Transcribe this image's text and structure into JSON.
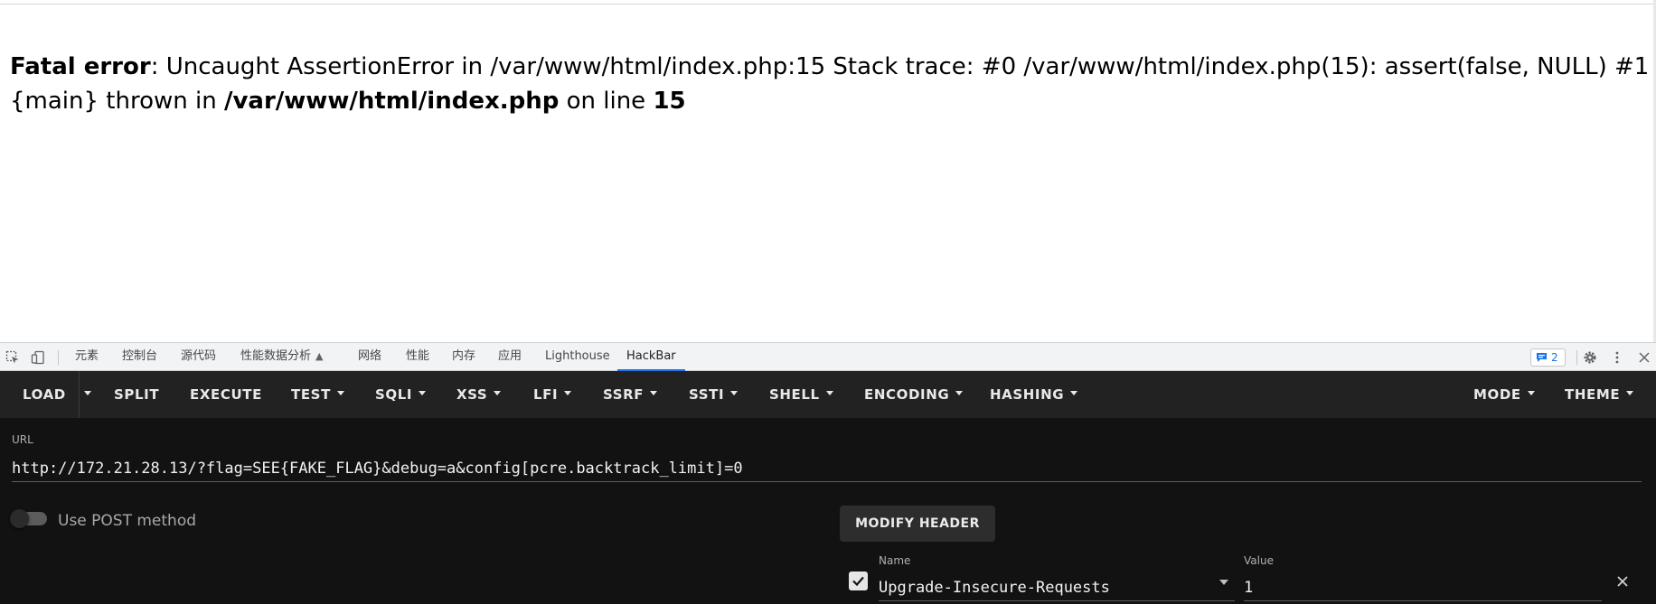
{
  "page": {
    "error_label": "Fatal error",
    "error_message": ": Uncaught AssertionError in /var/www/html/index.php:15 Stack trace: #0 /var/www/html/index.php(15): assert(false, NULL) #1 {main} thrown in ",
    "error_file": "/var/www/html/index.php",
    "on_line_text": " on line ",
    "line_number": "15"
  },
  "devtools": {
    "tabs": [
      {
        "label": "元素"
      },
      {
        "label": "控制台"
      },
      {
        "label": "源代码"
      },
      {
        "label": "性能数据分析"
      },
      {
        "label": "网络"
      },
      {
        "label": "性能"
      },
      {
        "label": "内存"
      },
      {
        "label": "应用"
      },
      {
        "label": "Lighthouse"
      },
      {
        "label": "HackBar"
      }
    ],
    "active_tab": "HackBar",
    "issues_count": "2",
    "accent_color": "#1a73e8"
  },
  "hackbar": {
    "menu": {
      "load": "LOAD",
      "split": "SPLIT",
      "execute": "EXECUTE",
      "test": "TEST",
      "sqli": "SQLI",
      "xss": "XSS",
      "lfi": "LFI",
      "ssrf": "SSRF",
      "ssti": "SSTI",
      "shell": "SHELL",
      "encoding": "ENCODING",
      "hashing": "HASHING",
      "mode": "MODE",
      "theme": "THEME"
    },
    "url_label": "URL",
    "url_value": "http://172.21.28.13/?flag=SEE{FAKE_FLAG}&debug=a&config[pcre.backtrack_limit]=0",
    "post_method_label": "Use POST method",
    "post_method_enabled": false,
    "modify_header_label": "MODIFY HEADER",
    "header": {
      "enabled": true,
      "name_label": "Name",
      "name_value": "Upgrade-Insecure-Requests",
      "value_label": "Value",
      "value_value": "1"
    }
  }
}
